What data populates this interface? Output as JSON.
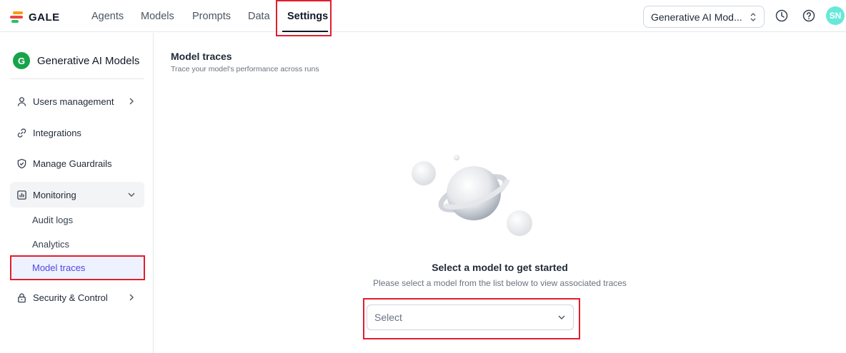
{
  "app": {
    "logo_text": "GALE"
  },
  "nav": {
    "tabs": [
      {
        "label": "Agents"
      },
      {
        "label": "Models"
      },
      {
        "label": "Prompts"
      },
      {
        "label": "Data"
      },
      {
        "label": "Settings",
        "active": true
      }
    ],
    "project_select_value": "Generative AI Mod...",
    "user_initials": "SN"
  },
  "sidebar": {
    "workspace": {
      "initial": "G",
      "name": "Generative AI Models"
    },
    "items": [
      {
        "label": "Users management",
        "icon": "user-icon",
        "has_chevron": true
      },
      {
        "label": "Integrations",
        "icon": "link-icon"
      },
      {
        "label": "Manage Guardrails",
        "icon": "shield-icon"
      },
      {
        "label": "Monitoring",
        "icon": "chart-icon",
        "expanded": true
      },
      {
        "label": "Security & Control",
        "icon": "lock-icon",
        "has_chevron": true
      }
    ],
    "monitoring_children": [
      {
        "label": "Audit logs"
      },
      {
        "label": "Analytics"
      },
      {
        "label": "Model traces",
        "active": true
      }
    ]
  },
  "main": {
    "title": "Model traces",
    "subtitle": "Trace your model's performance across runs",
    "empty_state": {
      "title": "Select a model to get started",
      "description": "Please select a model from the list below to view associated traces",
      "select_placeholder": "Select"
    }
  },
  "colors": {
    "highlight": "#e11d2f",
    "active_nav": "#4f46e5",
    "avatar_user": "#67e8d9",
    "avatar_workspace": "#16a34a"
  }
}
